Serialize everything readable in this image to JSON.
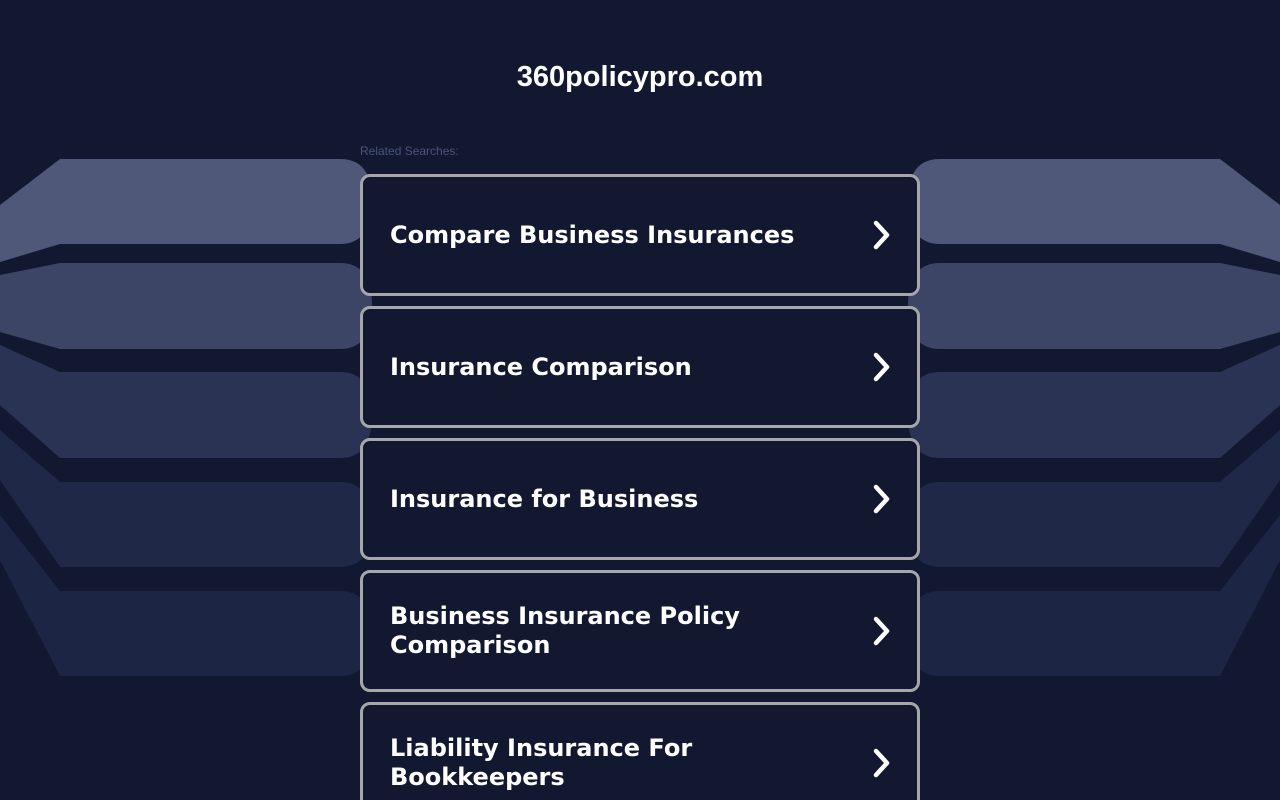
{
  "header": {
    "domain": "360policypro.com"
  },
  "related": {
    "label": "Related Searches:",
    "items": [
      {
        "label": "Compare Business Insurances",
        "icon": "chevron-right-icon"
      },
      {
        "label": "Insurance Comparison",
        "icon": "chevron-right-icon"
      },
      {
        "label": "Insurance for Business",
        "icon": "chevron-right-icon"
      },
      {
        "label": "Business Insurance Policy Comparison",
        "icon": "chevron-right-icon"
      },
      {
        "label": "Liability Insurance For Bookkeepers",
        "icon": "chevron-right-icon"
      }
    ]
  },
  "colors": {
    "background": "#111830",
    "card_border": "#a5a7ab",
    "text": "#ffffff",
    "muted_text": "#4a5577",
    "band_1": "#4f5878",
    "band_2": "#3c4566",
    "band_3": "#2a3354",
    "band_4": "#1f2847",
    "band_5": "#1c2544"
  }
}
